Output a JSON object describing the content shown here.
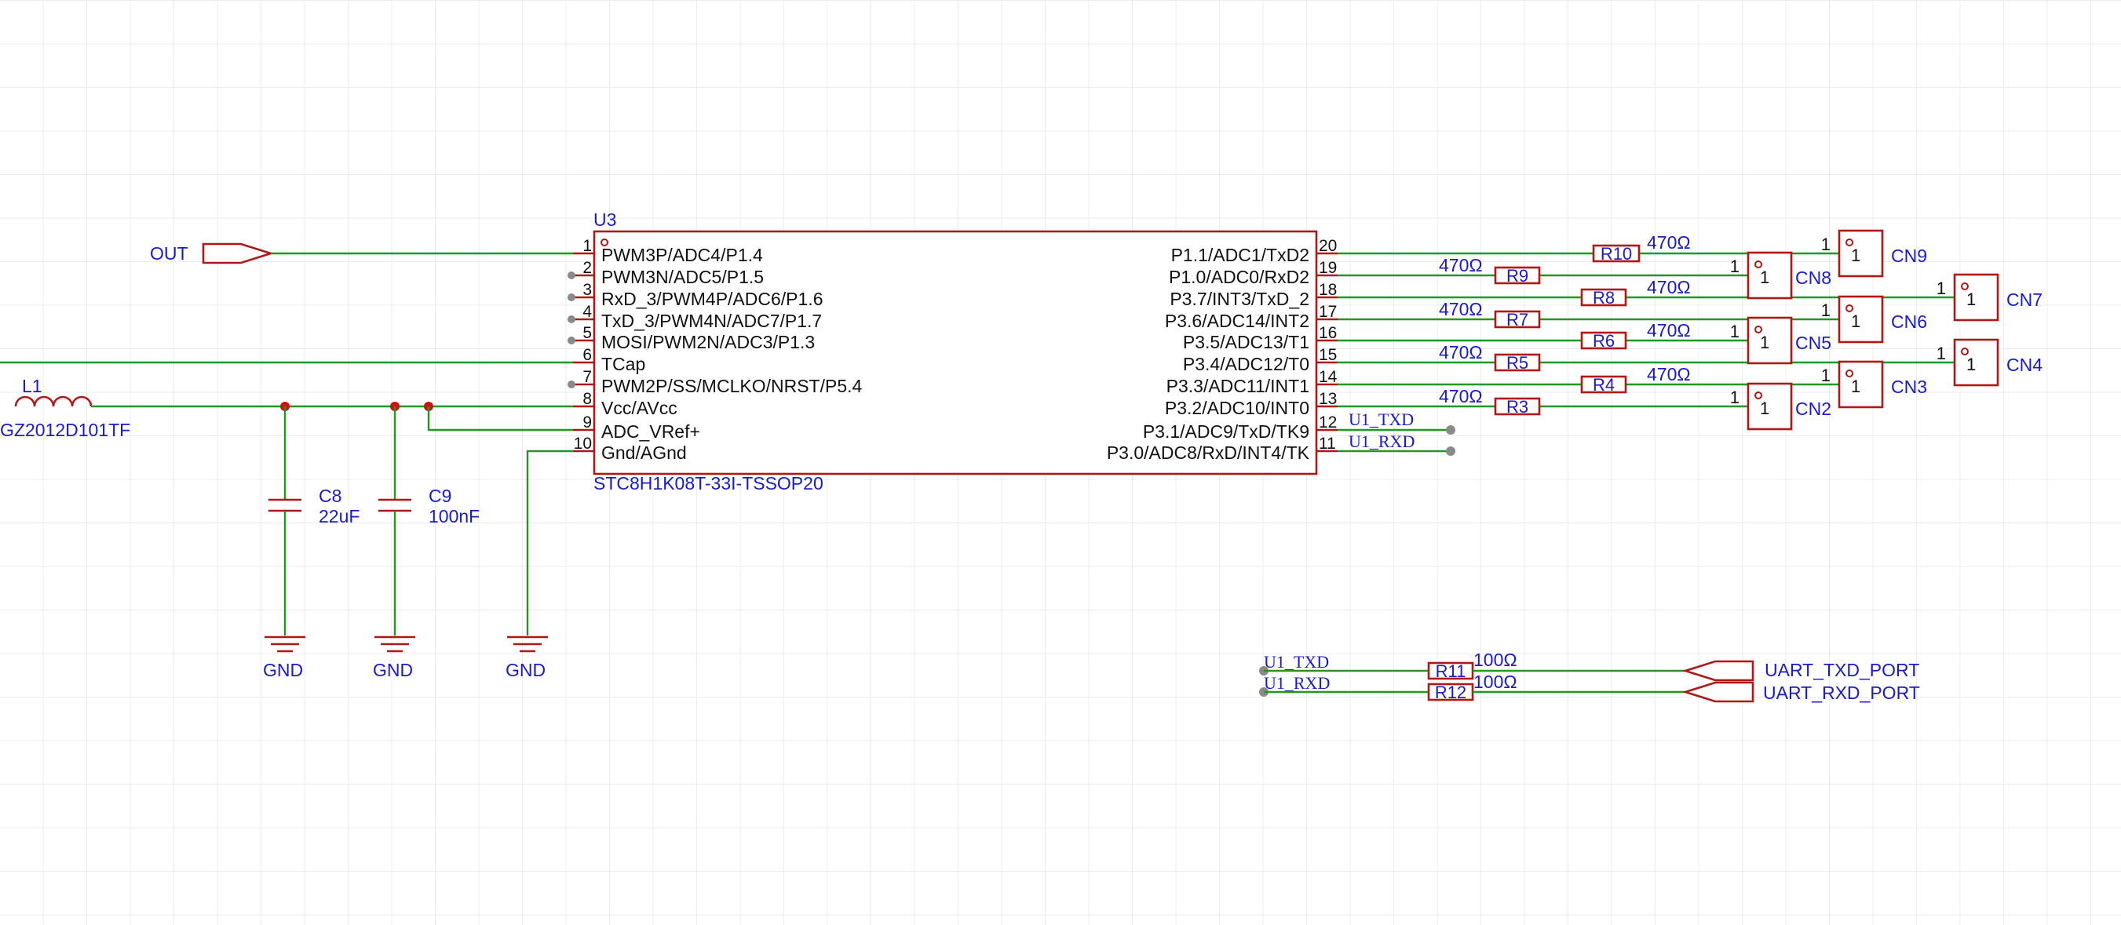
{
  "schematic": {
    "ic": {
      "ref": "U3",
      "part": "STC8H1K08T-33I-TSSOP20",
      "left_pins": [
        {
          "num": "1",
          "name": "PWM3P/ADC4/P1.4"
        },
        {
          "num": "2",
          "name": "PWM3N/ADC5/P1.5"
        },
        {
          "num": "3",
          "name": "RxD_3/PWM4P/ADC6/P1.6"
        },
        {
          "num": "4",
          "name": "TxD_3/PWM4N/ADC7/P1.7"
        },
        {
          "num": "5",
          "name": "MOSI/PWM2N/ADC3/P1.3"
        },
        {
          "num": "6",
          "name": "TCap"
        },
        {
          "num": "7",
          "name": "PWM2P/SS/MCLKO/NRST/P5.4"
        },
        {
          "num": "8",
          "name": "Vcc/AVcc"
        },
        {
          "num": "9",
          "name": "ADC_VRef+"
        },
        {
          "num": "10",
          "name": "Gnd/AGnd"
        }
      ],
      "right_pins": [
        {
          "num": "20",
          "name": "P1.1/ADC1/TxD2"
        },
        {
          "num": "19",
          "name": "P1.0/ADC0/RxD2"
        },
        {
          "num": "18",
          "name": "P3.7/INT3/TxD_2"
        },
        {
          "num": "17",
          "name": "P3.6/ADC14/INT2"
        },
        {
          "num": "16",
          "name": "P3.5/ADC13/T1"
        },
        {
          "num": "15",
          "name": "P3.4/ADC12/T0"
        },
        {
          "num": "14",
          "name": "P3.3/ADC11/INT1"
        },
        {
          "num": "13",
          "name": "P3.2/ADC10/INT0"
        },
        {
          "num": "12",
          "name": "P3.1/ADC9/TxD/TK9"
        },
        {
          "num": "11",
          "name": "P3.0/ADC8/RxD/INT4/TK"
        }
      ]
    },
    "out_port": "OUT",
    "inductor": {
      "ref": "L1",
      "part": "GZ2012D101TF"
    },
    "caps": [
      {
        "ref": "C8",
        "value": "22uF"
      },
      {
        "ref": "C9",
        "value": "100nF"
      }
    ],
    "gnd_label": "GND",
    "resistors": [
      {
        "ref": "R10",
        "value": "470Ω"
      },
      {
        "ref": "R9",
        "value": "470Ω"
      },
      {
        "ref": "R8",
        "value": "470Ω"
      },
      {
        "ref": "R7",
        "value": "470Ω"
      },
      {
        "ref": "R6",
        "value": "470Ω"
      },
      {
        "ref": "R5",
        "value": "470Ω"
      },
      {
        "ref": "R4",
        "value": "470Ω"
      },
      {
        "ref": "R3",
        "value": "470Ω"
      }
    ],
    "connectors": [
      {
        "ref": "CN9",
        "pin": "1"
      },
      {
        "ref": "CN8",
        "pin": "1"
      },
      {
        "ref": "CN7",
        "pin": "1"
      },
      {
        "ref": "CN6",
        "pin": "1"
      },
      {
        "ref": "CN5",
        "pin": "1"
      },
      {
        "ref": "CN4",
        "pin": "1"
      },
      {
        "ref": "CN3",
        "pin": "1"
      },
      {
        "ref": "CN2",
        "pin": "1"
      }
    ],
    "nets": {
      "txd": "U1_TXD",
      "rxd": "U1_RXD"
    },
    "uart": {
      "r_tx": {
        "ref": "R11",
        "value": "100Ω"
      },
      "r_rx": {
        "ref": "R12",
        "value": "100Ω"
      },
      "tx_port": "UART_TXD_PORT",
      "rx_port": "UART_RXD_PORT"
    },
    "colors": {
      "wire": "#1f9a1f",
      "component": "#b01717",
      "designator": "#1a1ad0",
      "junction": "#cc1111"
    }
  }
}
